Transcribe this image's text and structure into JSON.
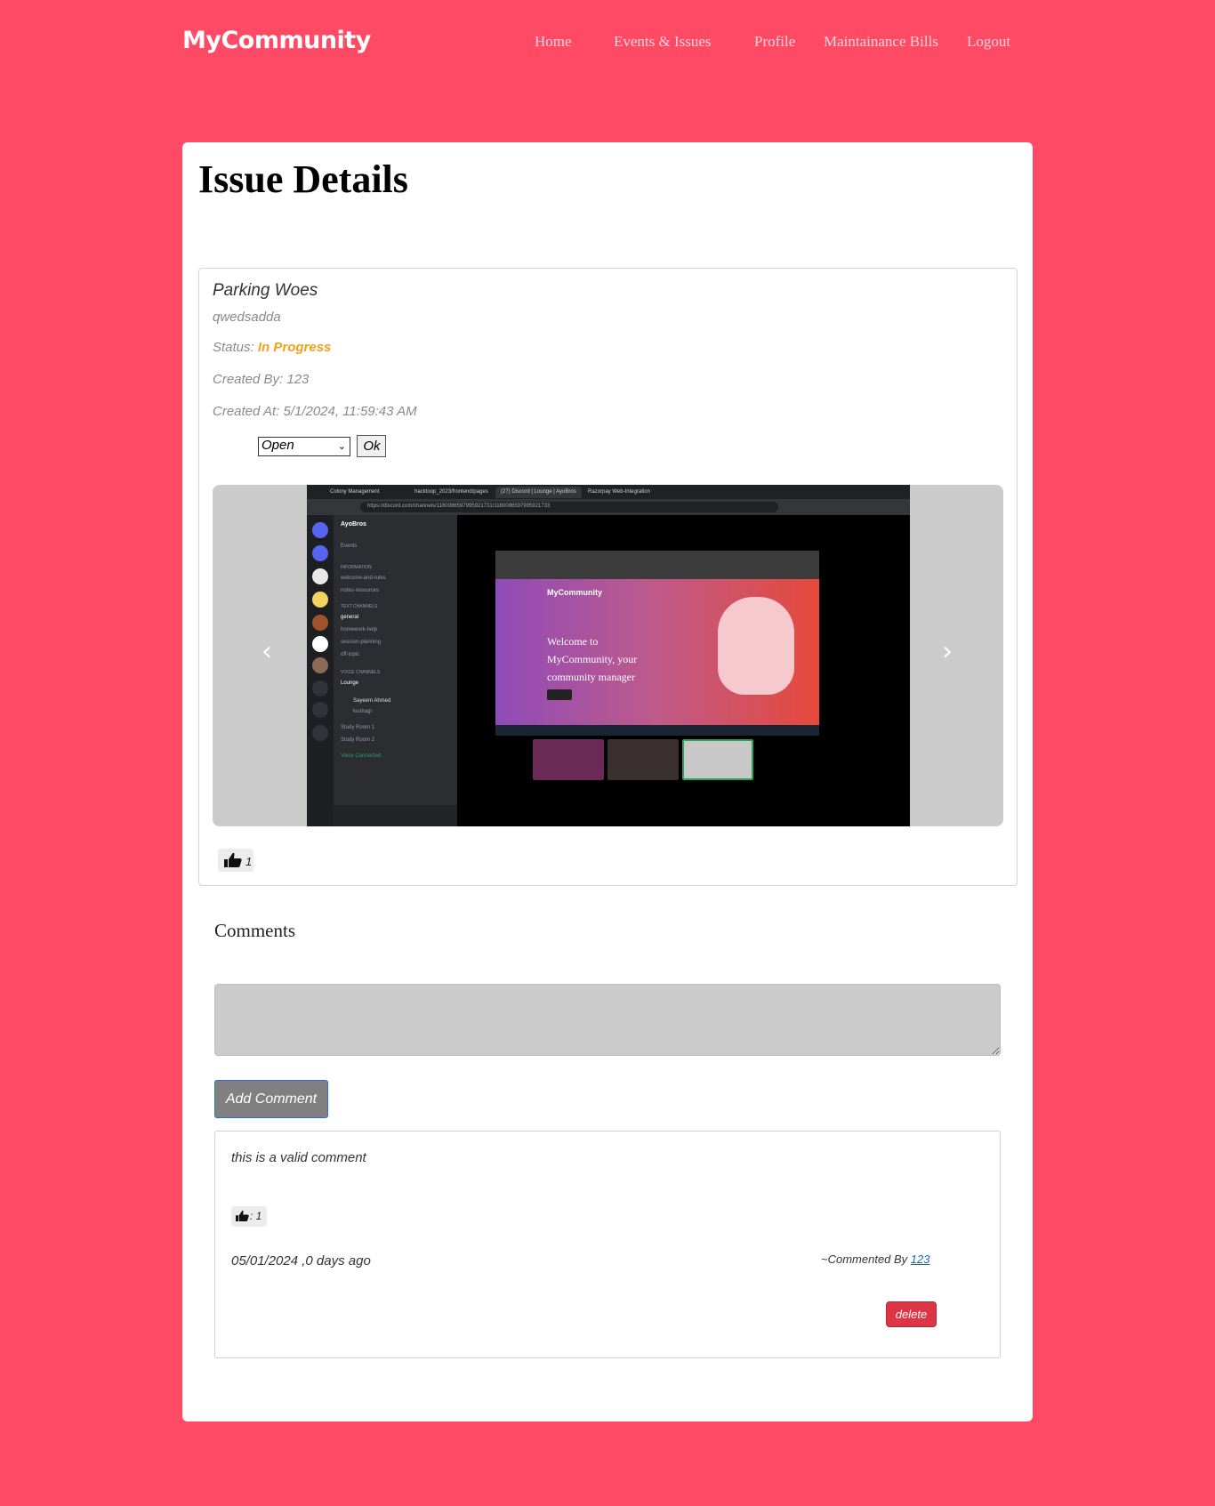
{
  "nav": {
    "brand": "MyCommunity",
    "links": [
      "Home",
      "Events & Issues",
      "Profile",
      "Maintainance Bills",
      "Logout"
    ]
  },
  "page": {
    "title": "Issue Details"
  },
  "issue": {
    "title": "Parking Woes",
    "description": "qwedsadda",
    "status_label": "Status:",
    "status_value": "In Progress",
    "created_by": "Created By: 123",
    "created_at": "Created At: 5/1/2024, 11:59:43 AM",
    "status_select_value": "Open",
    "ok_label": "Ok",
    "likes": "1",
    "carousel": {
      "prev_icon": "chevron-left-icon",
      "next_icon": "chevron-right-icon",
      "image": {
        "tabs": [
          "Colony Management",
          "hacktoop_2023/frontend/pages",
          "(27) Discord | Lounge | AyoBros",
          "Razorpay Web-Integration"
        ],
        "url": "https://discord.com/channels/1180086597995921731/1180086597995921733",
        "server_name": "AyoBros",
        "channels": [
          "Events",
          "INFORMATION",
          "welcome-and-rules",
          "notes-resources",
          "TEXT CHANNELS",
          "general",
          "homework-help",
          "session-planning",
          "off-topic",
          "VOICE CHANNELS",
          "Lounge",
          "Sayeem Ahmed",
          "kushagr",
          "Study Room 1",
          "Study Room 2",
          "Voice Connected"
        ],
        "inner_brand": "MyCommunity",
        "inner_hero_text": [
          "Welcome to",
          "MyCommunity, your",
          "community manager"
        ]
      }
    }
  },
  "comments": {
    "title": "Comments",
    "input_placeholder": "",
    "add_label": "Add Comment",
    "items": [
      {
        "text": "this is a valid comment",
        "likes": ": 1",
        "date": "05/01/2024 ,0 days ago",
        "by_prefix": "~Commented By ",
        "by_user": "123",
        "delete_label": "delete"
      }
    ]
  },
  "colors": {
    "background": "#ff4a66",
    "status_in_progress": "#f5a019",
    "delete": "#dc3545",
    "link": "#1d63d6"
  }
}
